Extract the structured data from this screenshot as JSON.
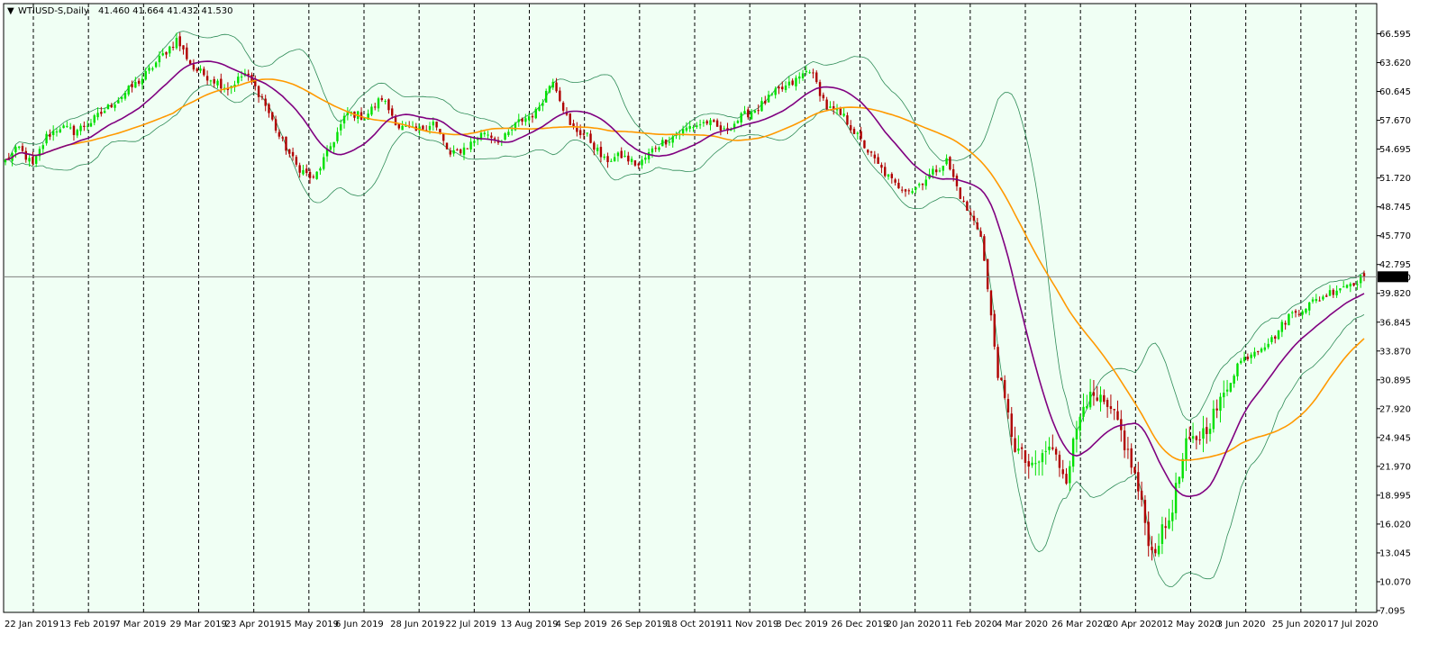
{
  "title": {
    "triangle": "▼",
    "symbol": "WTIUSD-S,Daily",
    "ohlc": "41.460 41.664 41.432 41.530"
  },
  "colors": {
    "background": "#F0FFF4",
    "grid": "#000000",
    "bull_candle": "#00E000",
    "bear_candle": "#B00000",
    "bollinger": "#2E8B57",
    "ma_fast": "#800080",
    "ma_slow": "#FF9900",
    "price_line": "#808080",
    "price_label_bg": "#000000",
    "price_label_text": "#FFFFFF"
  },
  "price_label": "41.530",
  "chart_data": {
    "type": "candlestick",
    "symbol": "WTIUSD-S",
    "timeframe": "Daily",
    "last": {
      "open": 41.46,
      "high": 41.664,
      "low": 41.432,
      "close": 41.53
    },
    "ylim": [
      7.095,
      66.595
    ],
    "y_ticks": [
      "66.595",
      "63.620",
      "60.645",
      "57.670",
      "54.695",
      "51.720",
      "48.745",
      "45.770",
      "42.795",
      "39.820",
      "36.845",
      "33.870",
      "30.895",
      "27.920",
      "24.945",
      "21.970",
      "18.995",
      "16.020",
      "13.045",
      "10.070",
      "7.095"
    ],
    "x_ticks": [
      "22 Jan 2019",
      "13 Feb 2019",
      "7 Mar 2019",
      "29 Mar 2019",
      "23 Apr 2019",
      "15 May 2019",
      "6 Jun 2019",
      "28 Jun 2019",
      "22 Jul 2019",
      "13 Aug 2019",
      "4 Sep 2019",
      "26 Sep 2019",
      "18 Oct 2019",
      "11 Nov 2019",
      "3 Dec 2019",
      "26 Dec 2019",
      "20 Jan 2020",
      "11 Feb 2020",
      "4 Mar 2020",
      "26 Mar 2020",
      "20 Apr 2020",
      "12 May 2020",
      "3 Jun 2020",
      "25 Jun 2020",
      "17 Jul 2020"
    ],
    "close_path": {
      "x": [
        0,
        4,
        8,
        12,
        16,
        20,
        25,
        30,
        35,
        40,
        45,
        50,
        55,
        60,
        65,
        70,
        75,
        80,
        85,
        90,
        95,
        100,
        105,
        110,
        115,
        120,
        125,
        130,
        135,
        140,
        145,
        150,
        155,
        160,
        165,
        170,
        175,
        180,
        185,
        190,
        195,
        200,
        205,
        210,
        215,
        220,
        225,
        230,
        235,
        240,
        245,
        250,
        255,
        260,
        265,
        270,
        275,
        280,
        285,
        290,
        295,
        300,
        305,
        310,
        315,
        320,
        325,
        330,
        335,
        340,
        345,
        350,
        355,
        360,
        365,
        370,
        375,
        380,
        385,
        390,
        394,
        397
      ],
      "y": [
        53.5,
        54.8,
        53.0,
        56.0,
        57.0,
        56.5,
        57.5,
        59.0,
        60.5,
        62.0,
        64.0,
        66.0,
        63.0,
        62.0,
        61.0,
        62.5,
        60.0,
        56.0,
        53.0,
        51.5,
        55.0,
        58.5,
        58.0,
        60.0,
        57.0,
        56.5,
        57.5,
        54.0,
        55.0,
        56.5,
        55.5,
        57.5,
        58.5,
        62.0,
        57.0,
        56.0,
        53.5,
        54.0,
        53.0,
        55.0,
        56.0,
        57.0,
        57.5,
        56.5,
        58.0,
        59.0,
        60.5,
        61.5,
        63.0,
        59.0,
        58.0,
        55.5,
        53.0,
        51.0,
        50.5,
        52.0,
        53.5,
        49.0,
        46.0,
        31.5,
        24.0,
        21.5,
        24.0,
        21.0,
        29.0,
        28.5,
        26.5,
        21.0,
        13.0,
        16.5,
        24.0,
        25.5,
        28.5,
        32.5,
        34.0,
        35.0,
        37.5,
        38.5,
        39.5,
        40.5,
        41.0,
        41.53
      ]
    },
    "indicators": [
      {
        "name": "Bollinger Bands",
        "type": "bands"
      },
      {
        "name": "MA fast",
        "type": "line"
      },
      {
        "name": "MA slow",
        "type": "line"
      }
    ]
  }
}
